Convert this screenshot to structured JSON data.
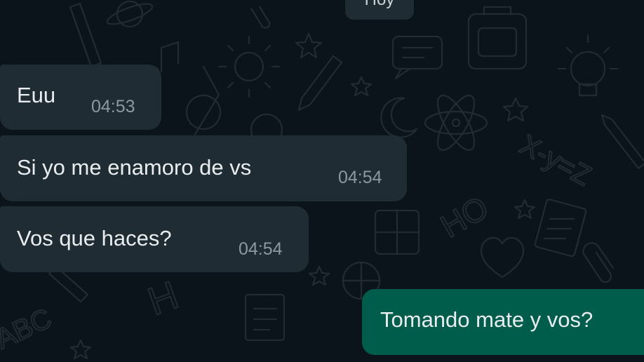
{
  "chat": {
    "date_label": "Hoy",
    "messages": [
      {
        "text": "Euu",
        "time": "04:53",
        "direction": "incoming"
      },
      {
        "text": "Si yo me enamoro de vs",
        "time": "04:54",
        "direction": "incoming"
      },
      {
        "text": "Vos que haces?",
        "time": "04:54",
        "direction": "incoming"
      },
      {
        "text": "Tomando mate y vos?",
        "direction": "outgoing"
      }
    ]
  },
  "colors": {
    "background": "#0b141a",
    "incoming_bubble": "#1f2c33",
    "outgoing_bubble": "#005c4b",
    "timestamp": "#8d999f"
  },
  "wallpaper": {
    "doodle_text": [
      "ABC",
      "H",
      "HO",
      "X-y=Z"
    ]
  }
}
